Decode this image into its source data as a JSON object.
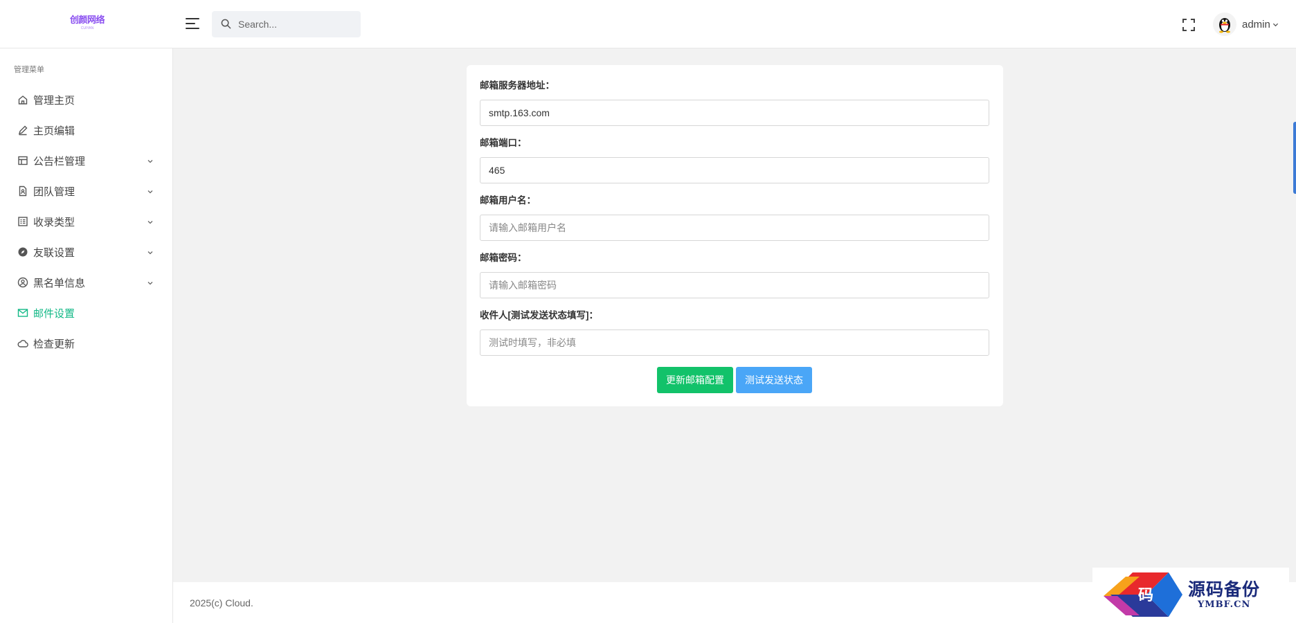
{
  "header": {
    "logo_text": "创颜网络",
    "logo_subtext": "CUIYAN",
    "search_placeholder": "Search...",
    "user_name": "admin"
  },
  "sidebar": {
    "heading": "管理菜单",
    "items": [
      {
        "label": "管理主页",
        "icon": "home-icon",
        "has_submenu": false
      },
      {
        "label": "主页编辑",
        "icon": "pencil-icon",
        "has_submenu": false
      },
      {
        "label": "公告栏管理",
        "icon": "layout-icon",
        "has_submenu": true
      },
      {
        "label": " 团队管理",
        "icon": "file-user-icon",
        "has_submenu": true
      },
      {
        "label": "收录类型",
        "icon": "list-box-icon",
        "has_submenu": true
      },
      {
        "label": "友联设置",
        "icon": "compass-icon",
        "has_submenu": true
      },
      {
        "label": "黑名单信息",
        "icon": "user-circle-icon",
        "has_submenu": true
      },
      {
        "label": "邮件设置",
        "icon": "mail-icon",
        "has_submenu": false,
        "active": true
      },
      {
        "label": "检查更新",
        "icon": "cloud-icon",
        "has_submenu": false
      }
    ]
  },
  "form": {
    "smtp_host": {
      "label": "邮箱服务器地址：",
      "value": "smtp.163.com",
      "placeholder": ""
    },
    "smtp_port": {
      "label": "邮箱端口：",
      "value": "465",
      "placeholder": ""
    },
    "username": {
      "label": "邮箱用户名：",
      "value": "",
      "placeholder": "请输入邮箱用户名"
    },
    "password": {
      "label": "邮箱密码：",
      "value": "",
      "placeholder": "请输入邮箱密码"
    },
    "recipient": {
      "label": "收件人[测试发送状态填写]：",
      "value": "",
      "placeholder": "测试时填写，非必填"
    },
    "update_button": "更新邮箱配置",
    "test_button": "测试发送状态"
  },
  "footer": {
    "text": "2025(c) Cloud."
  },
  "watermark": {
    "title": "源码备份",
    "site": "YMBF.CN",
    "mark": "码"
  },
  "colors": {
    "accent": "#12b886",
    "primary_button": "#12c26a",
    "secondary_button": "#4aa6f7"
  }
}
